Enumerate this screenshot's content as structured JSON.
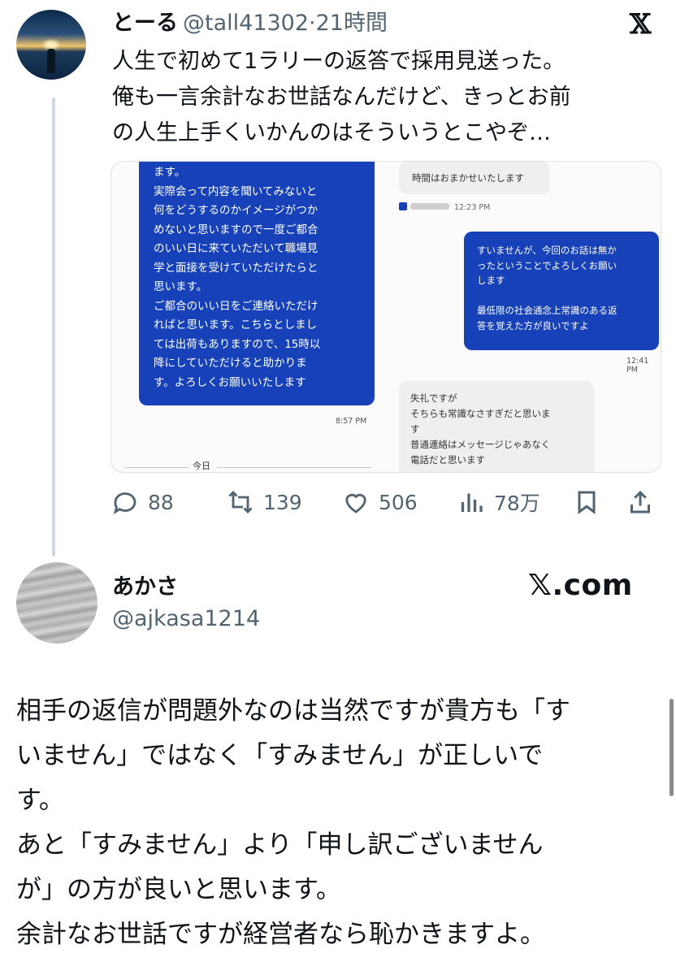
{
  "tweet1": {
    "name": "とーる",
    "handle": "@tall41302",
    "time": "·21時間",
    "text": "人生で初めて1ラリーの返答で採用見送った。\n俺も一言余計なお世話なんだけど、きっとお前\nの人生上手くいかんのはそういうとこやぞ…",
    "logo": "𝕏",
    "screenshot": {
      "left_bubble": "ます。\n実際会って内容を聞いてみないと\n何をどうするのかイメージがつか\nめないと思いますので一度ご都合\nのいい日に来ていただいて職場見\n学と面接を受けていただけたらと\n思います。\nご都合のいい日をご連絡いただけ\nればと思います。こちらとしまし\nては出荷もありますので、15時以\n降にしていただけると助かりま\nす。よろしくお願いいたします",
      "left_time": "8:57 PM",
      "grey_bubble_1": "時間はおまかせいたします",
      "sender_time": "12:23 PM",
      "right_bubble": "すいませんが、今回のお話は無か\nったということでよろしくお願い\nします\n\n最低限の社会通念上常識のある返\n答を覚えた方が良いですよ",
      "right_time": "12:41 PM",
      "grey_bubble_2": "失礼ですが\nそちらも常識なさすぎだと思いま\nす\n普通連絡はメッセージじゃあなく\n電話だと思います",
      "today_label": "今日"
    },
    "actions": {
      "replies": "88",
      "reposts": "139",
      "likes": "506",
      "views": "78万"
    }
  },
  "tweet2": {
    "name": "あかさ",
    "handle": "@ajkasa1214",
    "brand": "𝕏.com",
    "text": "相手の返信が問題外なのは当然ですが貴方も「す\nいません」ではなく「すみません」が正しいで\nす。\nあと「すみません」より「申し訳ございません\nが」の方が良いと思います。\n余計なお世話ですが経営者なら恥かきますよ。"
  },
  "colors": {
    "text": "#0f1419",
    "secondary": "#536471",
    "bubble_blue": "#1641b8",
    "bubble_grey": "#efefef"
  }
}
